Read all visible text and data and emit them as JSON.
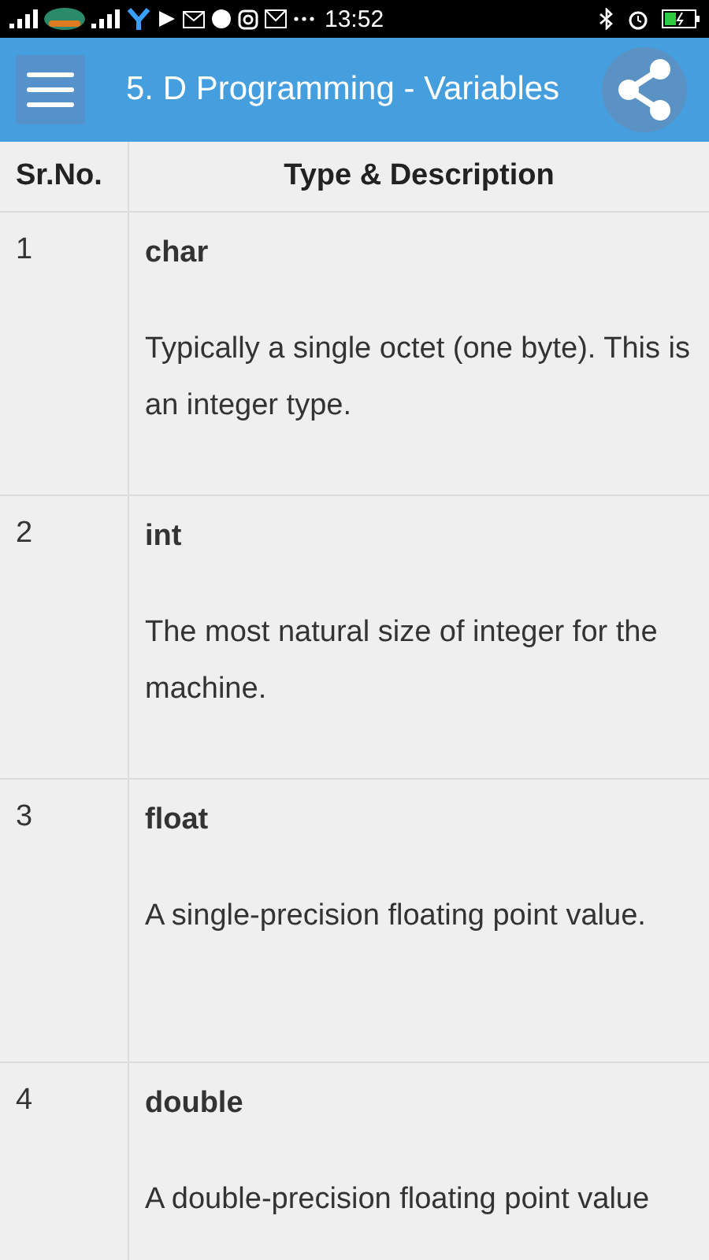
{
  "status_bar": {
    "time": "13:52"
  },
  "header": {
    "title": "5. D Programming - Variables"
  },
  "table": {
    "columns": [
      "Sr.No.",
      "Type & Description"
    ],
    "rows": [
      {
        "number": "1",
        "type": "char",
        "description": "Typically a single octet (one byte). This is an integer type."
      },
      {
        "number": "2",
        "type": "int",
        "description": "The most natural size of integer for the machine."
      },
      {
        "number": "3",
        "type": "float",
        "description": "A single-precision floating point value."
      },
      {
        "number": "4",
        "type": "double",
        "description": "A double-precision floating point value"
      }
    ]
  }
}
